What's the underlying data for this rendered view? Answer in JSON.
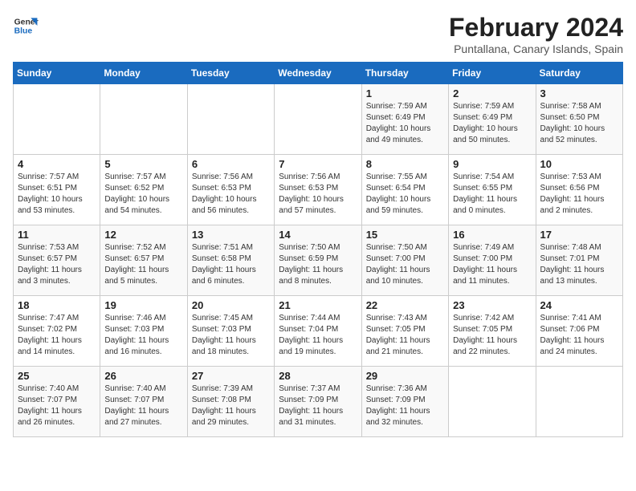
{
  "logo": {
    "line1": "General",
    "line2": "Blue"
  },
  "title": "February 2024",
  "subtitle": "Puntallana, Canary Islands, Spain",
  "days_of_week": [
    "Sunday",
    "Monday",
    "Tuesday",
    "Wednesday",
    "Thursday",
    "Friday",
    "Saturday"
  ],
  "weeks": [
    [
      {
        "day": "",
        "info": ""
      },
      {
        "day": "",
        "info": ""
      },
      {
        "day": "",
        "info": ""
      },
      {
        "day": "",
        "info": ""
      },
      {
        "day": "1",
        "info": "Sunrise: 7:59 AM\nSunset: 6:49 PM\nDaylight: 10 hours\nand 49 minutes."
      },
      {
        "day": "2",
        "info": "Sunrise: 7:59 AM\nSunset: 6:49 PM\nDaylight: 10 hours\nand 50 minutes."
      },
      {
        "day": "3",
        "info": "Sunrise: 7:58 AM\nSunset: 6:50 PM\nDaylight: 10 hours\nand 52 minutes."
      }
    ],
    [
      {
        "day": "4",
        "info": "Sunrise: 7:57 AM\nSunset: 6:51 PM\nDaylight: 10 hours\nand 53 minutes."
      },
      {
        "day": "5",
        "info": "Sunrise: 7:57 AM\nSunset: 6:52 PM\nDaylight: 10 hours\nand 54 minutes."
      },
      {
        "day": "6",
        "info": "Sunrise: 7:56 AM\nSunset: 6:53 PM\nDaylight: 10 hours\nand 56 minutes."
      },
      {
        "day": "7",
        "info": "Sunrise: 7:56 AM\nSunset: 6:53 PM\nDaylight: 10 hours\nand 57 minutes."
      },
      {
        "day": "8",
        "info": "Sunrise: 7:55 AM\nSunset: 6:54 PM\nDaylight: 10 hours\nand 59 minutes."
      },
      {
        "day": "9",
        "info": "Sunrise: 7:54 AM\nSunset: 6:55 PM\nDaylight: 11 hours\nand 0 minutes."
      },
      {
        "day": "10",
        "info": "Sunrise: 7:53 AM\nSunset: 6:56 PM\nDaylight: 11 hours\nand 2 minutes."
      }
    ],
    [
      {
        "day": "11",
        "info": "Sunrise: 7:53 AM\nSunset: 6:57 PM\nDaylight: 11 hours\nand 3 minutes."
      },
      {
        "day": "12",
        "info": "Sunrise: 7:52 AM\nSunset: 6:57 PM\nDaylight: 11 hours\nand 5 minutes."
      },
      {
        "day": "13",
        "info": "Sunrise: 7:51 AM\nSunset: 6:58 PM\nDaylight: 11 hours\nand 6 minutes."
      },
      {
        "day": "14",
        "info": "Sunrise: 7:50 AM\nSunset: 6:59 PM\nDaylight: 11 hours\nand 8 minutes."
      },
      {
        "day": "15",
        "info": "Sunrise: 7:50 AM\nSunset: 7:00 PM\nDaylight: 11 hours\nand 10 minutes."
      },
      {
        "day": "16",
        "info": "Sunrise: 7:49 AM\nSunset: 7:00 PM\nDaylight: 11 hours\nand 11 minutes."
      },
      {
        "day": "17",
        "info": "Sunrise: 7:48 AM\nSunset: 7:01 PM\nDaylight: 11 hours\nand 13 minutes."
      }
    ],
    [
      {
        "day": "18",
        "info": "Sunrise: 7:47 AM\nSunset: 7:02 PM\nDaylight: 11 hours\nand 14 minutes."
      },
      {
        "day": "19",
        "info": "Sunrise: 7:46 AM\nSunset: 7:03 PM\nDaylight: 11 hours\nand 16 minutes."
      },
      {
        "day": "20",
        "info": "Sunrise: 7:45 AM\nSunset: 7:03 PM\nDaylight: 11 hours\nand 18 minutes."
      },
      {
        "day": "21",
        "info": "Sunrise: 7:44 AM\nSunset: 7:04 PM\nDaylight: 11 hours\nand 19 minutes."
      },
      {
        "day": "22",
        "info": "Sunrise: 7:43 AM\nSunset: 7:05 PM\nDaylight: 11 hours\nand 21 minutes."
      },
      {
        "day": "23",
        "info": "Sunrise: 7:42 AM\nSunset: 7:05 PM\nDaylight: 11 hours\nand 22 minutes."
      },
      {
        "day": "24",
        "info": "Sunrise: 7:41 AM\nSunset: 7:06 PM\nDaylight: 11 hours\nand 24 minutes."
      }
    ],
    [
      {
        "day": "25",
        "info": "Sunrise: 7:40 AM\nSunset: 7:07 PM\nDaylight: 11 hours\nand 26 minutes."
      },
      {
        "day": "26",
        "info": "Sunrise: 7:40 AM\nSunset: 7:07 PM\nDaylight: 11 hours\nand 27 minutes."
      },
      {
        "day": "27",
        "info": "Sunrise: 7:39 AM\nSunset: 7:08 PM\nDaylight: 11 hours\nand 29 minutes."
      },
      {
        "day": "28",
        "info": "Sunrise: 7:37 AM\nSunset: 7:09 PM\nDaylight: 11 hours\nand 31 minutes."
      },
      {
        "day": "29",
        "info": "Sunrise: 7:36 AM\nSunset: 7:09 PM\nDaylight: 11 hours\nand 32 minutes."
      },
      {
        "day": "",
        "info": ""
      },
      {
        "day": "",
        "info": ""
      }
    ]
  ]
}
